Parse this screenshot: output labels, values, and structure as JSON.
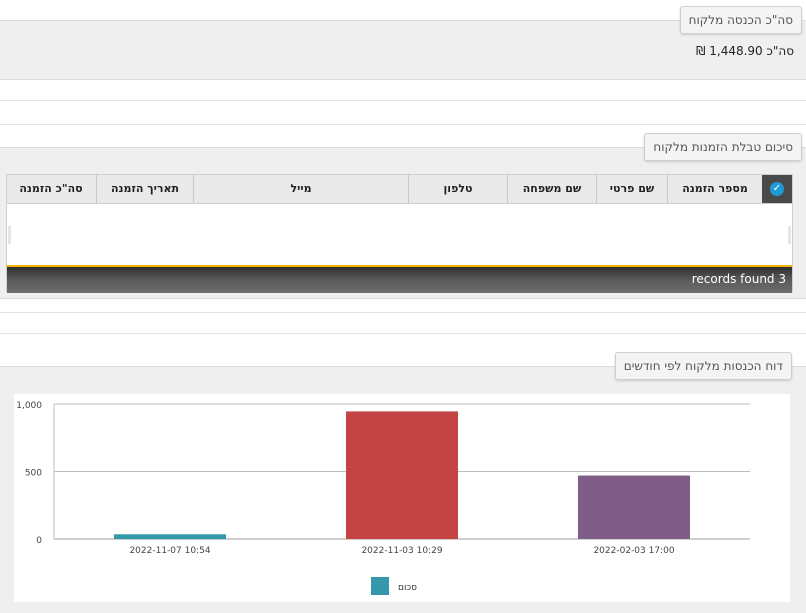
{
  "sections": {
    "income_total": {
      "legend": "סה\"כ הכנסה מלקוח",
      "total_text": "סה\"כ 1,448.90 ₪"
    },
    "orders_summary": {
      "legend": "סיכום טבלת הזמנות מלקוח",
      "columns": [
        "מספר הזמנה",
        "שם פרטי",
        "שם משפחה",
        "טלפון",
        "מייל",
        "תאריך הזמנה",
        "סה\"כ הזמנה"
      ],
      "records_text": "records found 3",
      "select_all_icon": "check-circle-icon"
    },
    "monthly_report": {
      "legend": "דוח הכנסות מלקוח לפי חודשים"
    }
  },
  "chart_data": {
    "type": "bar",
    "categories": [
      "2022-11-07 10:54",
      "2022-11-03 10:29",
      "2022-02-03 17:00"
    ],
    "values": [
      35,
      945,
      470
    ],
    "colors": [
      "#3399aa",
      "#c44444",
      "#805c88"
    ],
    "series": [
      {
        "name": "סכום",
        "values": [
          35,
          945,
          470
        ]
      }
    ],
    "legend_color": "#3399aa",
    "yticks": [
      "0",
      "500",
      "1,000"
    ],
    "ylim": [
      0,
      1000
    ],
    "grid": true,
    "legend_position": "bottom-center"
  }
}
